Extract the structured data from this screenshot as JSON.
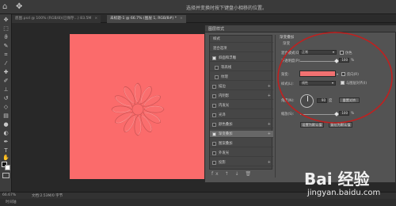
{
  "options_bar": {
    "hint": "选择并变换时按下键盘小相移的位置。"
  },
  "tabs": [
    {
      "label": "底图.psd @ 100% (RGB/8)(已保存...) 83.5M",
      "active": false
    },
    {
      "label": "未标题-1 @ 66.7% (图层 1, RGB/8#) *",
      "active": true
    }
  ],
  "layer_style_dialog": {
    "title": "图层样式",
    "left_list": [
      {
        "label": "样式",
        "checkbox": false,
        "checked": false,
        "plus": false,
        "selected": false
      },
      {
        "label": "混合选项",
        "checkbox": false,
        "checked": false,
        "plus": false,
        "selected": false
      },
      {
        "label": "斜面和浮雕",
        "checkbox": true,
        "checked": true,
        "plus": false,
        "selected": false
      },
      {
        "label": "等高线",
        "checkbox": true,
        "checked": false,
        "plus": false,
        "selected": false,
        "sub": true
      },
      {
        "label": "纹理",
        "checkbox": true,
        "checked": false,
        "plus": false,
        "selected": false,
        "sub": true
      },
      {
        "label": "描边",
        "checkbox": true,
        "checked": false,
        "plus": true,
        "selected": false
      },
      {
        "label": "内阴影",
        "checkbox": true,
        "checked": false,
        "plus": true,
        "selected": false
      },
      {
        "label": "内发光",
        "checkbox": true,
        "checked": false,
        "plus": false,
        "selected": false
      },
      {
        "label": "光泽",
        "checkbox": true,
        "checked": false,
        "plus": false,
        "selected": false
      },
      {
        "label": "颜色叠加",
        "checkbox": true,
        "checked": false,
        "plus": true,
        "selected": false
      },
      {
        "label": "渐变叠加",
        "checkbox": true,
        "checked": true,
        "plus": true,
        "selected": true
      },
      {
        "label": "图案叠加",
        "checkbox": true,
        "checked": false,
        "plus": false,
        "selected": false
      },
      {
        "label": "外发光",
        "checkbox": true,
        "checked": false,
        "plus": false,
        "selected": false
      },
      {
        "label": "投影",
        "checkbox": true,
        "checked": false,
        "plus": true,
        "selected": false
      }
    ],
    "footer_icons": "fx ↑ ↓ 🗑",
    "right": {
      "section": "渐变叠加",
      "subsection": "渐变",
      "blend_mode_label": "混合模式(O):",
      "blend_mode_value": "正常",
      "dither_label": "仿色",
      "opacity_label": "不透明度(P):",
      "opacity_value": "100",
      "opacity_unit": "%",
      "gradient_label": "渐变:",
      "reverse_label": "反向(R)",
      "style_label": "样式(L):",
      "style_value": "线性",
      "align_label": "与图层对齐(I)",
      "angle_label": "角度(N):",
      "angle_value": "90",
      "angle_unit": "度",
      "reset_align_button": "重置对齐",
      "scale_label": "缩放(S):",
      "scale_value": "100",
      "scale_unit": "%",
      "set_default_button": "设置为默认值",
      "reset_default_button": "复位为默认值",
      "opacity_level": 1.0,
      "scale_level": 1.0
    }
  },
  "status": {
    "zoom": "66.67%",
    "doc": "文档:2.53M/0 字节"
  },
  "timeline_label": "时间轴",
  "watermark": {
    "logo": "Bai 经验",
    "url": "jingyan.baidu.com"
  },
  "colors": {
    "canvas": "#fb6b6b",
    "gradient_swatch": "#f27171",
    "annotation_circle": "#c0201f"
  },
  "icons": {
    "home": "home-icon",
    "move": "move-tool-icon"
  }
}
